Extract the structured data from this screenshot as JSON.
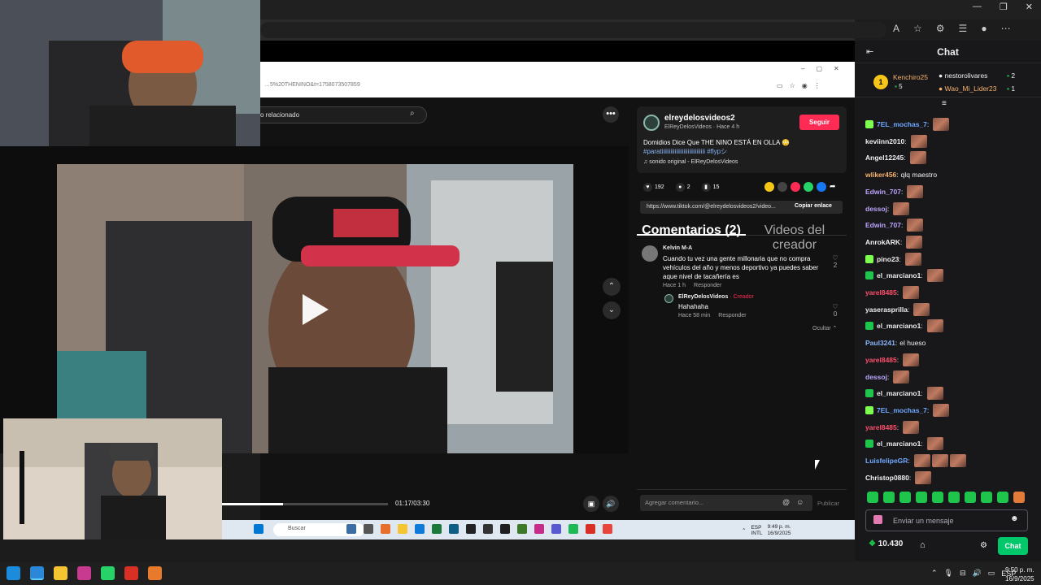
{
  "window": {
    "minimize": "—",
    "maximize": "❐",
    "close": "✕"
  },
  "inner_browser": {
    "url": "…5%20THENINO&t=1758073507859",
    "controls": [
      "–",
      "▢",
      "✕"
    ]
  },
  "tiktok": {
    "search_placeholder": "o relacionado",
    "user": "elreydelosvideos2",
    "handle": "ElReyDelosVideos · Hace 4 h",
    "follow": "Seguir",
    "caption": "Domidios Dice Que THE NINO ESTÁ EN OLLA 😳",
    "hashtags": "#paratiiiiiiiiiiiiiiiiiiiiiiiiiiiiii #flypシ",
    "sound": "♫ sonido original - ElReyDelosVideos",
    "likes": "192",
    "comments": "2",
    "saves": "15",
    "link": "https://www.tiktok.com/@elreydelosvideos2/video...",
    "copy": "Copiar enlace",
    "tab_comments": "Comentarios (2)",
    "tab_videos": "Videos del creador",
    "comment": {
      "name": "Kelvin M-A",
      "text": "Cuando tu vez una gente millonaria que no compra vehículos del año y menos deportivo ya puedes saber aque nivel de tacañería es",
      "time": "Hace 1 h",
      "reply": "Responder",
      "likes": "2"
    },
    "reply": {
      "name": "ElReyDelosVideos",
      "creator": " · Creador",
      "text": "Hahahaha",
      "time": "Hace 58 min",
      "reply": "Responder",
      "likes": "0"
    },
    "hide": "Ocultar ⌃",
    "input_placeholder": "Agregar comentario...",
    "publish": "Publicar",
    "time": "01:17/03:30",
    "progress": 0.37
  },
  "inner_taskbar": {
    "search": "Buscar",
    "lang": "ESP\nINTL",
    "time": "9:49 p. m.",
    "date": "16/9/2025"
  },
  "chat": {
    "title": "Chat",
    "leader": {
      "rank": "1",
      "name": "Kenchiro25",
      "count": "5",
      "others": [
        {
          "name": "nestorolivares",
          "count": "2"
        },
        {
          "name": "Wao_Mi_Lider23",
          "count": "1"
        }
      ]
    },
    "messages": [
      {
        "user": "7EL_mochas_7",
        "color": "#6fa8ff",
        "text": "",
        "emotes": 1,
        "badge": "#7dff4f"
      },
      {
        "user": "keviinn2010",
        "color": "#efeff1",
        "text": "",
        "emotes": 1,
        "badge": ""
      },
      {
        "user": "Angel12245",
        "color": "#efeff1",
        "text": "",
        "emotes": 1,
        "badge": ""
      },
      {
        "user": "wliker456",
        "color": "#f6b26b",
        "text": "qlq maestro",
        "emotes": 0,
        "badge": ""
      },
      {
        "user": "Edwin_707",
        "color": "#bda5ff",
        "text": "",
        "emotes": 1,
        "badge": ""
      },
      {
        "user": "dessoj",
        "color": "#bda5ff",
        "text": "",
        "emotes": 1,
        "badge": ""
      },
      {
        "user": "Edwin_707",
        "color": "#bda5ff",
        "text": "",
        "emotes": 1,
        "badge": ""
      },
      {
        "user": "AnrokARK",
        "color": "#efeff1",
        "text": "",
        "emotes": 1,
        "badge": ""
      },
      {
        "user": "pino23",
        "color": "#efeff1",
        "text": "",
        "emotes": 1,
        "badge": "#7dff4f"
      },
      {
        "user": "el_marciano1",
        "color": "#efeff1",
        "text": "",
        "emotes": 1,
        "badge": "#1ec44b"
      },
      {
        "user": "yarel8485",
        "color": "#ff4f6b",
        "text": "",
        "emotes": 1,
        "badge": ""
      },
      {
        "user": "yaserasprilla",
        "color": "#efeff1",
        "text": "",
        "emotes": 1,
        "badge": ""
      },
      {
        "user": "el_marciano1",
        "color": "#efeff1",
        "text": "",
        "emotes": 1,
        "badge": "#1ec44b"
      },
      {
        "user": "Paul3241",
        "color": "#8ab4f8",
        "text": "el hueso",
        "emotes": 0,
        "badge": ""
      },
      {
        "user": "yarel8485",
        "color": "#ff4f6b",
        "text": "",
        "emotes": 1,
        "badge": ""
      },
      {
        "user": "dessoj",
        "color": "#bda5ff",
        "text": "",
        "emotes": 1,
        "badge": ""
      },
      {
        "user": "el_marciano1",
        "color": "#efeff1",
        "text": "",
        "emotes": 1,
        "badge": "#1ec44b"
      },
      {
        "user": "7EL_mochas_7",
        "color": "#6fa8ff",
        "text": "",
        "emotes": 1,
        "badge": "#7dff4f"
      },
      {
        "user": "yarel8485",
        "color": "#ff4f6b",
        "text": "",
        "emotes": 1,
        "badge": ""
      },
      {
        "user": "el_marciano1",
        "color": "#efeff1",
        "text": "",
        "emotes": 1,
        "badge": "#1ec44b"
      },
      {
        "user": "LuisfelipeGR",
        "color": "#6fa8ff",
        "text": "",
        "emotes": 3,
        "badge": ""
      },
      {
        "user": "Christop0880",
        "color": "#efeff1",
        "text": "",
        "emotes": 1,
        "badge": ""
      }
    ],
    "input_placeholder": "Enviar un mensaje",
    "points": "10.430",
    "chat_button": "Chat"
  },
  "taskbar": {
    "lang": "ESP",
    "time": "9:50 p. m.",
    "date": "16/9/2025"
  }
}
